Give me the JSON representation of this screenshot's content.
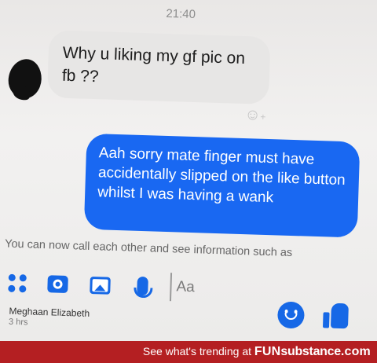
{
  "status": {
    "time": "21:40"
  },
  "messages": [
    {
      "direction": "incoming",
      "text": "Why u liking my gf pic on fb ??"
    },
    {
      "direction": "outgoing",
      "text": "Aah sorry mate finger must have accidentally slipped on the like button whilst I was having a wank"
    }
  ],
  "notice": "You can now call each other and see information such as",
  "composer": {
    "placeholder": "Aa",
    "icons": [
      "apps-icon",
      "camera-icon",
      "photo-icon",
      "mic-icon",
      "emoji-icon",
      "like-icon"
    ]
  },
  "contact": {
    "name": "Meghaan Elizabeth",
    "time": "3 hrs"
  },
  "footer": {
    "prefix": "See what's trending at",
    "brand_a": "FUN",
    "brand_b": "substance",
    "brand_c": ".com"
  },
  "colors": {
    "accent": "#1668e6",
    "bubble_out": "#1968f2",
    "footer_bg": "#b41f22"
  }
}
